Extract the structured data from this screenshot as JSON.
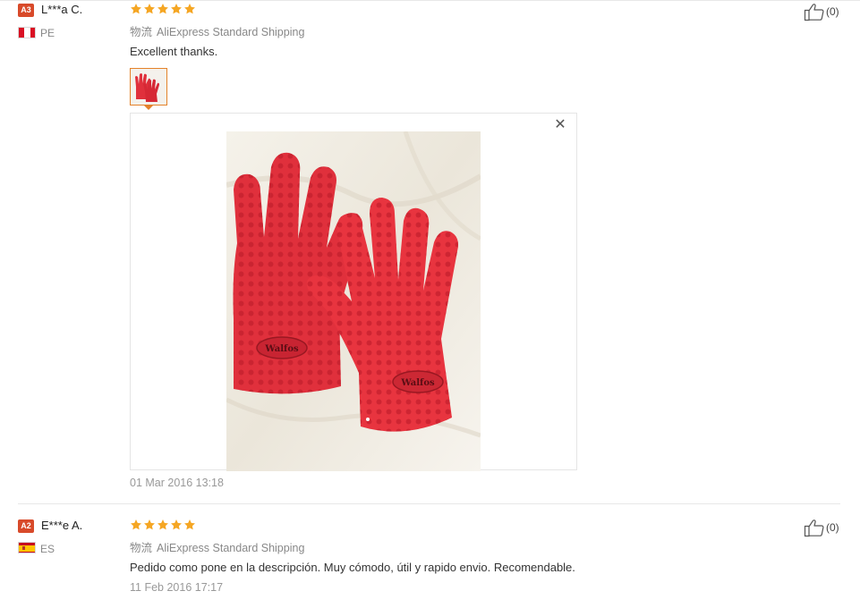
{
  "reviews": [
    {
      "user_level": "A3",
      "user_name": "L***a C.",
      "country_code": "PE",
      "rating": 5,
      "shipping_label": "物流",
      "shipping_method": "AliExpress Standard Shipping",
      "feedback": "Excellent thanks.",
      "date": "01 Mar 2016 13:18",
      "like_count": "(0)",
      "photo_logo": "Walfos"
    },
    {
      "user_level": "A2",
      "user_name": "E***e A.",
      "country_code": "ES",
      "rating": 5,
      "shipping_label": "物流",
      "shipping_method": "AliExpress Standard Shipping",
      "feedback": "Pedido como pone en la descripción. Muy cómodo, útil y rapido envio. Recomendable.",
      "date": "11 Feb 2016 17:17",
      "like_count": "(0)"
    }
  ],
  "colors": {
    "badge": "#d84a2a",
    "star": "#f5a623",
    "thumb_border": "#e4822a",
    "glove": "#e0303c"
  },
  "icons": {
    "close": "close-icon",
    "like": "thumbs-up-icon",
    "star": "star-icon"
  }
}
